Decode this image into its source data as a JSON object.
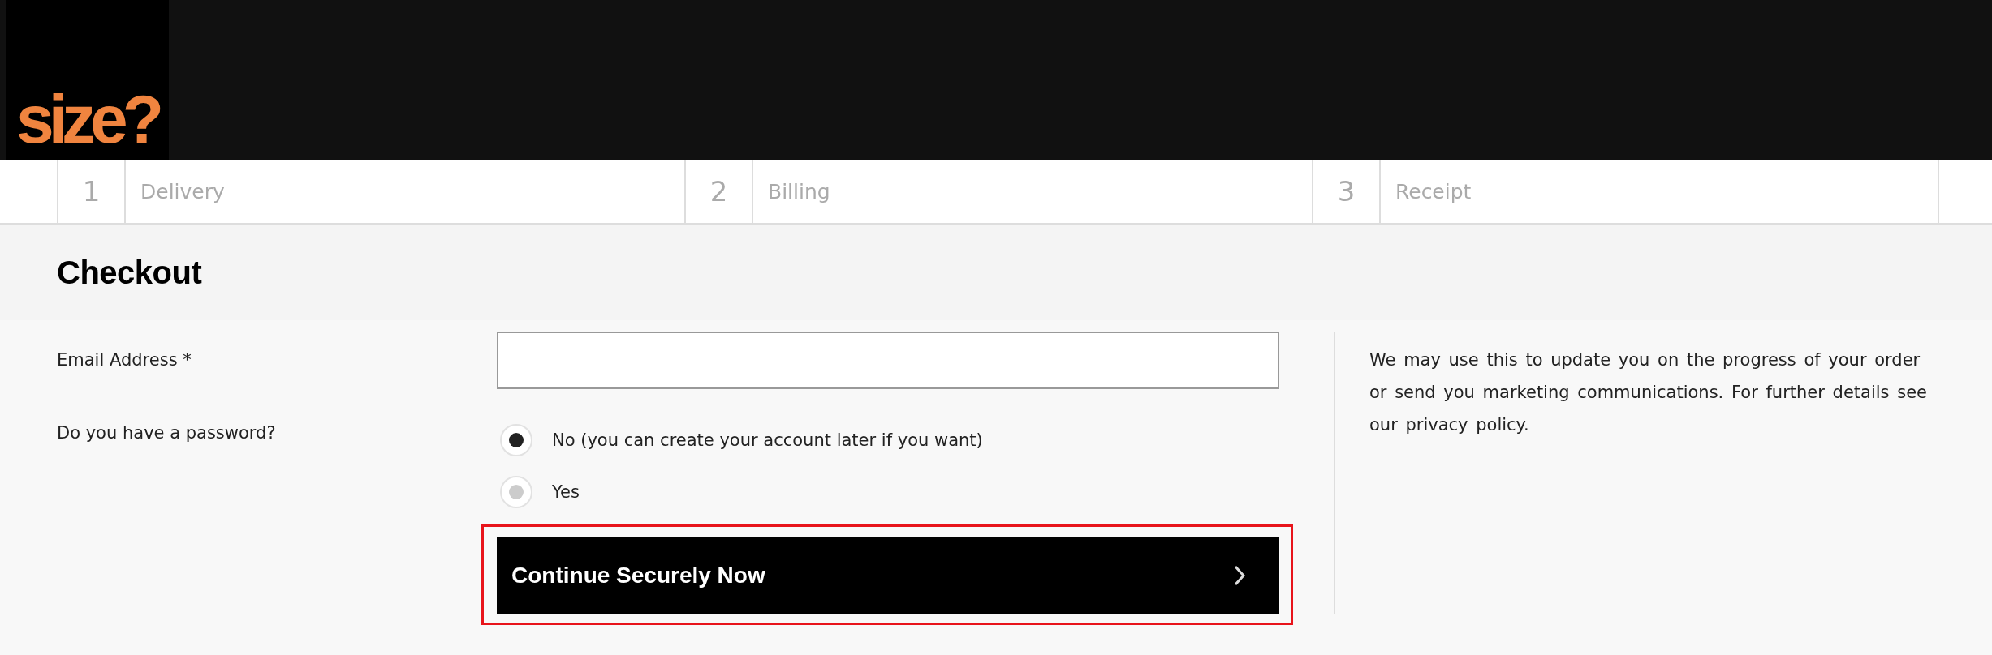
{
  "header": {
    "logo": "size?"
  },
  "steps": [
    {
      "number": "1",
      "label": "Delivery"
    },
    {
      "number": "2",
      "label": "Billing"
    },
    {
      "number": "3",
      "label": "Receipt"
    }
  ],
  "page": {
    "title": "Checkout"
  },
  "form": {
    "email": {
      "label": "Email Address *"
    },
    "password": {
      "label": "Do you have a password?",
      "options": [
        {
          "label": "No (you can create your account later if you want)",
          "selected": true
        },
        {
          "label": "Yes",
          "selected": false
        }
      ]
    },
    "continue_button": {
      "label": "Continue Securely Now",
      "focused": true
    }
  },
  "note": "We may use this to update you on the progress of your order or send you marketing communications. For further details see our privacy policy."
}
